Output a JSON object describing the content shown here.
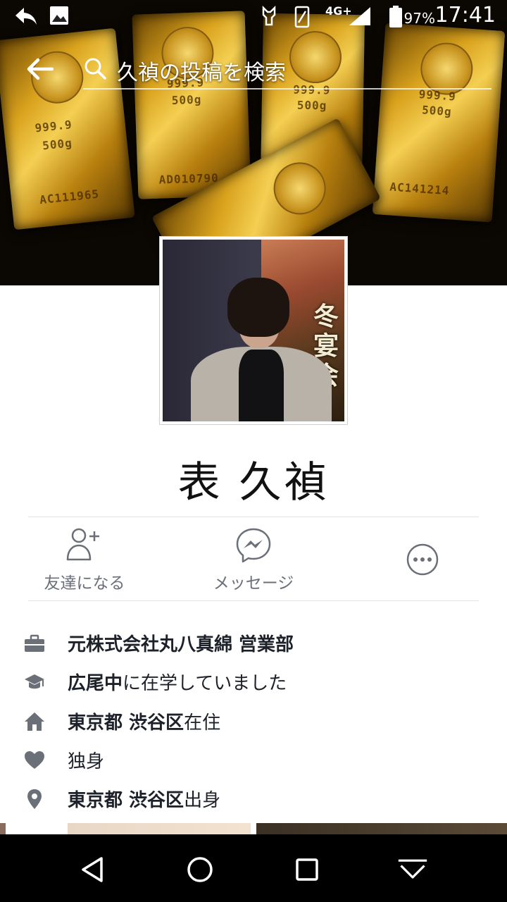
{
  "status_bar": {
    "network": "4G+",
    "battery_percent": "97%",
    "time": "17:41"
  },
  "search": {
    "placeholder": "久禎の投稿を検索"
  },
  "cover": {
    "bars": [
      {
        "text_top": "999.9",
        "text_mid": "500g",
        "serial": "AC111965"
      },
      {
        "text_top": "999.9",
        "text_mid": "500g",
        "serial": "AD010790"
      },
      {
        "text_top": "999.9",
        "text_mid": "500g",
        "serial": ""
      },
      {
        "text_top": "999.9",
        "text_mid": "500g",
        "serial": "AC141214"
      }
    ]
  },
  "profile": {
    "name": "表 久禎",
    "avatar_poster_text": [
      "冬",
      "宴",
      "会"
    ]
  },
  "actions": {
    "add_friend_label": "友達になる",
    "message_label": "メッセージ"
  },
  "info": {
    "work": {
      "bold": "元株式会社丸八真綿 営業部",
      "rest": ""
    },
    "education": {
      "bold": "広尾中",
      "rest": "に在学していました"
    },
    "lives": {
      "bold": "東京都 渋谷区",
      "rest": "在住"
    },
    "relationship": {
      "bold": "",
      "rest": "独身"
    },
    "from": {
      "bold": "東京都 渋谷区",
      "rest": "出身"
    }
  },
  "colors": {
    "icon_gray": "#6b6f78",
    "text_dark": "#1d2129",
    "label_gray": "#6a6f7a"
  }
}
